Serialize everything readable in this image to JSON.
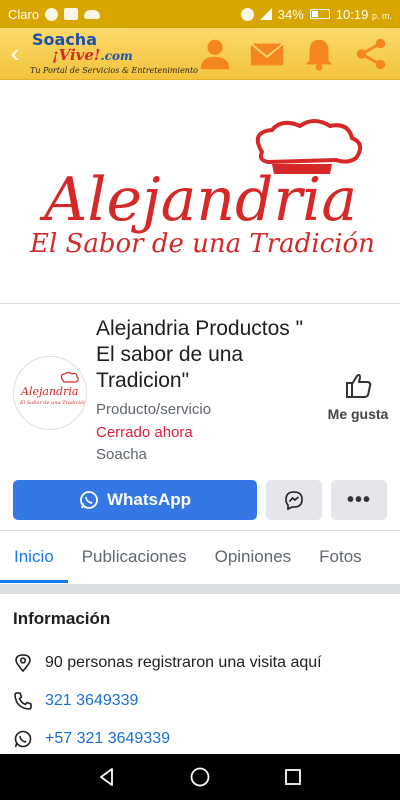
{
  "status_bar": {
    "carrier": "Claro",
    "battery": "34%",
    "time": "10:19",
    "ampm": "p. m."
  },
  "app_header": {
    "logo_line1": "Soacha",
    "logo_line2": "¡Vive!",
    "logo_line2_suffix": ".com",
    "tagline": "Tu Portal de Servicios & Entretenimiento",
    "icons": [
      "user-icon",
      "mail-icon",
      "bell-icon",
      "share-icon"
    ]
  },
  "cover": {
    "brand": "Alejandria",
    "slogan": "El Sabor de una Tradición"
  },
  "page": {
    "name": "Alejandria Productos \" El sabor de una Tradicion\"",
    "category": "Producto/servicio",
    "status": "Cerrado ahora",
    "location": "Soacha",
    "like_label": "Me gusta"
  },
  "actions": {
    "whatsapp_label": "WhatsApp",
    "more_label": "•••"
  },
  "tabs": [
    {
      "label": "Inicio",
      "active": true
    },
    {
      "label": "Publicaciones",
      "active": false
    },
    {
      "label": "Opiniones",
      "active": false
    },
    {
      "label": "Fotos",
      "active": false
    }
  ],
  "info": {
    "heading": "Información",
    "visits": "90 personas registraron una visita aquí",
    "phone": "321 3649339",
    "whatsapp": "+57 321 3649339"
  },
  "colors": {
    "status_bar": "#d9a500",
    "app_header": "#f3c43d",
    "primary_blue": "#3578e5",
    "brand_red": "#d62828",
    "closed_red": "#e41e3f"
  }
}
